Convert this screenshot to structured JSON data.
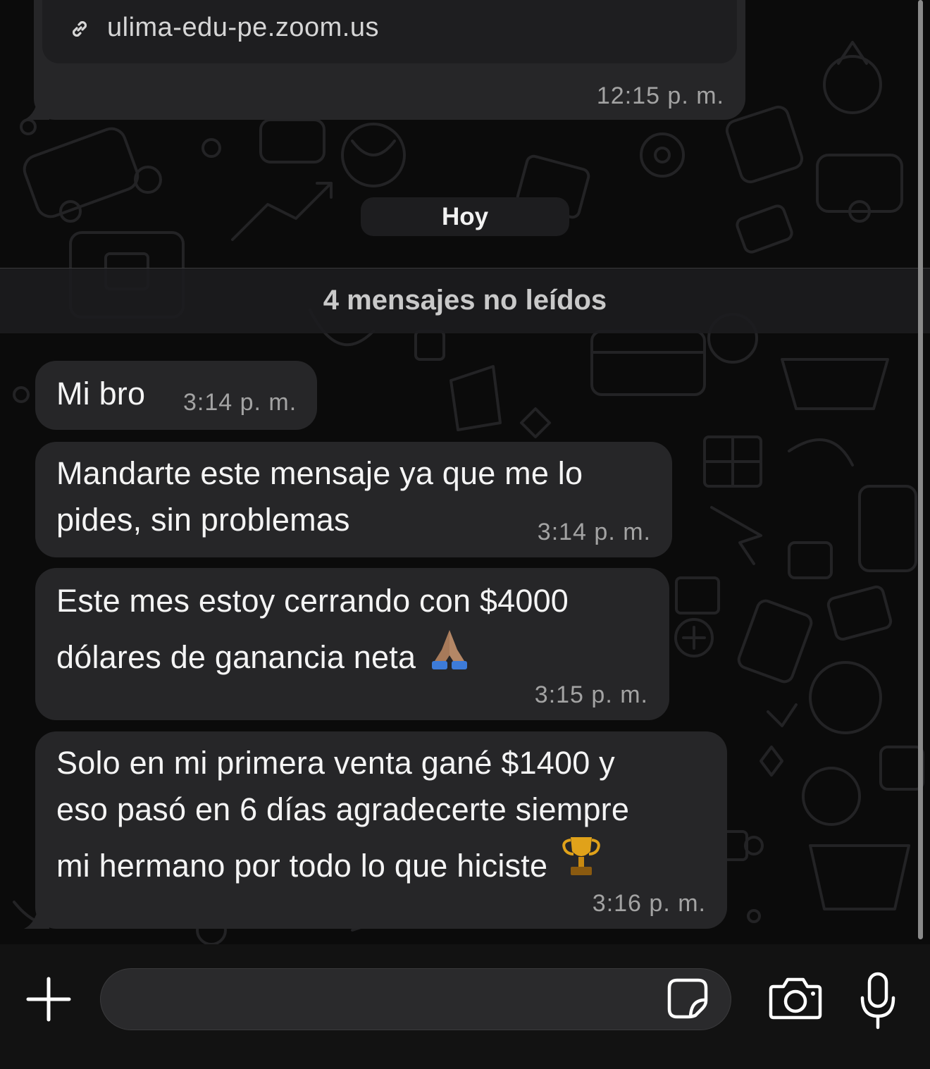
{
  "link_message": {
    "url": "ulima-edu-pe.zoom.us",
    "time": "12:15 p. m."
  },
  "date_divider": "Hoy",
  "unread_banner": "4 mensajes no leídos",
  "messages": [
    {
      "text": "Mi bro",
      "time": "3:14 p. m."
    },
    {
      "lines": [
        "Mandarte este mensaje ya que me lo",
        "pides, sin problemas"
      ],
      "time": "3:14 p. m."
    },
    {
      "lines": [
        "Este mes estoy cerrando con $4000",
        "dólares de ganancia neta"
      ],
      "emoji": "folded-hands",
      "time": "3:15 p. m."
    },
    {
      "lines": [
        "Solo en mi primera venta gané $1400 y",
        "eso pasó en 6 días agradecerte siempre",
        "mi hermano por todo lo que hiciste"
      ],
      "emoji": "trophy",
      "time": "3:16 p. m."
    }
  ],
  "composer": {
    "placeholder": "",
    "icons": [
      "plus-icon",
      "sticker-icon",
      "camera-icon",
      "microphone-icon"
    ]
  }
}
